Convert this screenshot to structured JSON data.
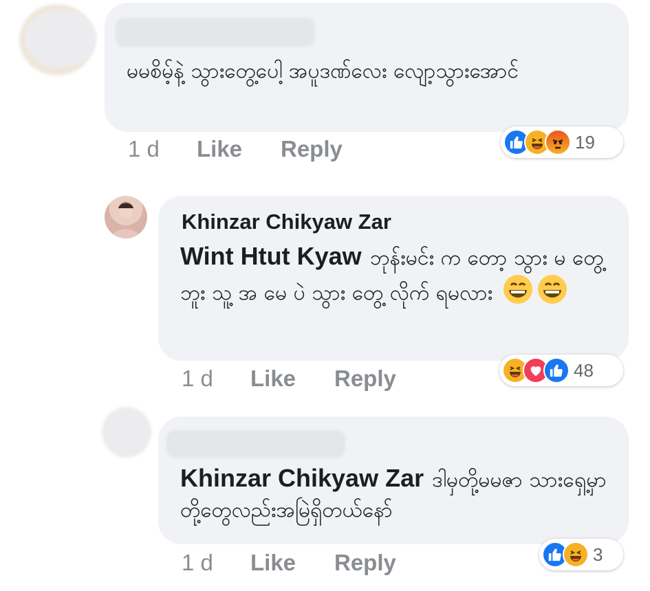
{
  "comments": [
    {
      "text": "မမစိမ့်နဲ့ သွားတွေ့ပေါ့ အပူဒဏ်လေး လျော့သွားအောင်",
      "time": "1 d",
      "like_label": "Like",
      "reply_label": "Reply",
      "reactions": [
        "like",
        "haha",
        "angry"
      ],
      "reaction_count": "19"
    },
    {
      "author": "Khinzar Chikyaw Zar",
      "mention": "Wint Htut Kyaw",
      "text": "ဘုန်းမင်း က တော့ သွား မ တွေ့ ဘူး သူ့ အ မေ ပဲ သွား တွေ့ လိုက် ရမလား",
      "time": "1 d",
      "like_label": "Like",
      "reply_label": "Reply",
      "reactions": [
        "haha",
        "love",
        "like"
      ],
      "reaction_count": "48"
    },
    {
      "mention": "Khinzar Chikyaw Zar",
      "text": "ဒါမှတို့မမဇာ သားရှေ့မှာတို့တွေလည်းအမြဲရှိတယ်နော်",
      "time": "1 d",
      "like_label": "Like",
      "reply_label": "Reply",
      "reactions": [
        "like",
        "haha"
      ],
      "reaction_count": "3"
    }
  ],
  "colors": {
    "like": "#1877f2",
    "love": "#f33e58",
    "haha": "#f7b125",
    "angry": "#e9710f",
    "bubble": "#f0f2f5",
    "meta_text": "#8a8d91"
  }
}
